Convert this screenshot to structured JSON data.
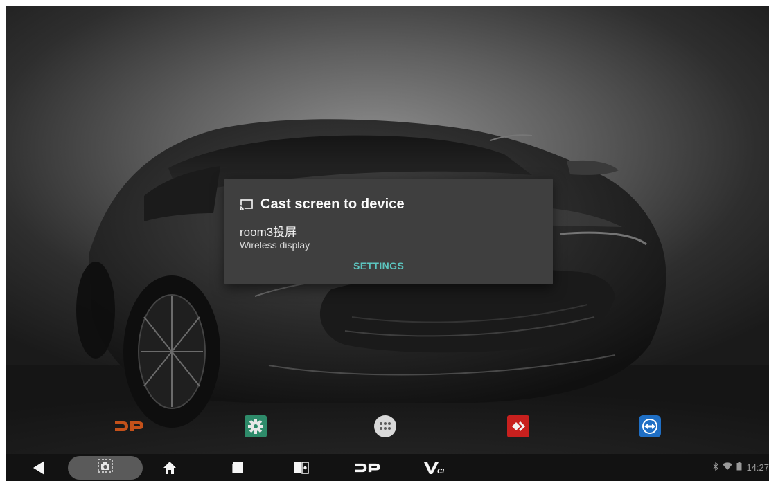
{
  "dialog": {
    "title": "Cast screen to device",
    "device_name": "room3投屏",
    "device_subtitle": "Wireless display",
    "settings_label": "SETTINGS"
  },
  "dock": {
    "items": [
      {
        "icon": "dp-logo-icon"
      },
      {
        "icon": "settings-gear-icon"
      },
      {
        "icon": "app-drawer-icon"
      },
      {
        "icon": "diagnostic-app-icon"
      },
      {
        "icon": "teamviewer-icon"
      }
    ]
  },
  "nav_bar": {
    "buttons": [
      {
        "icon": "back-icon"
      },
      {
        "icon": "screenshot-icon"
      },
      {
        "icon": "home-icon"
      },
      {
        "icon": "recents-icon"
      },
      {
        "icon": "screen-mirror-icon"
      },
      {
        "icon": "dp-icon"
      },
      {
        "icon": "vci-icon"
      }
    ]
  },
  "status_bar": {
    "time": "14:27",
    "icons": [
      "bluetooth-icon",
      "wifi-icon",
      "battery-icon"
    ]
  },
  "colors": {
    "dialog_bg": "#3f3f3f",
    "accent": "#5cc6c0",
    "nav_bg": "#121212",
    "dock_settings_green": "#2e8b6a",
    "dock_red": "#c8201e",
    "dock_teamviewer_blue": "#1f6fc5"
  }
}
